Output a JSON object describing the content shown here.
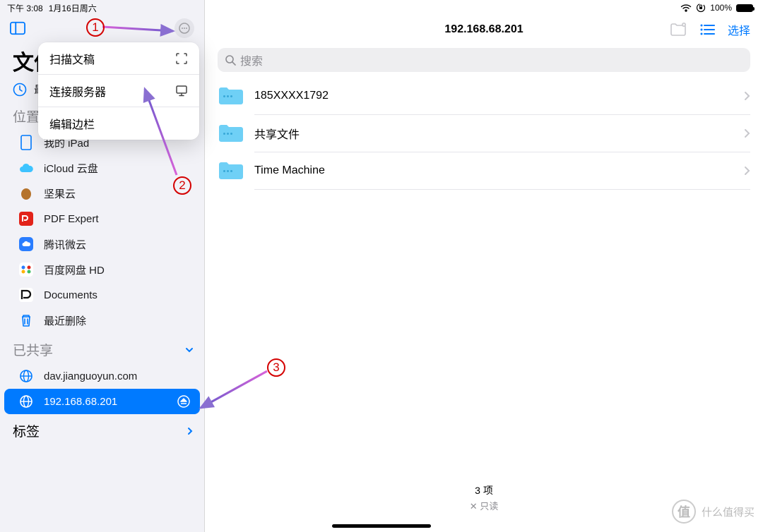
{
  "status": {
    "time": "下午 3:08",
    "date": "1月16日周六",
    "battery": "100%"
  },
  "sidebar": {
    "title": "文件",
    "recent": "最近",
    "sections": {
      "locations": {
        "label": "位置",
        "items": [
          {
            "label": "我的 iPad"
          },
          {
            "label": "iCloud 云盘"
          },
          {
            "label": "坚果云"
          },
          {
            "label": "PDF Expert"
          },
          {
            "label": "腾讯微云"
          },
          {
            "label": "百度网盘 HD"
          },
          {
            "label": "Documents"
          },
          {
            "label": "最近删除"
          }
        ]
      },
      "shared": {
        "label": "已共享",
        "items": [
          {
            "label": "dav.jianguoyun.com"
          },
          {
            "label": "192.168.68.201"
          }
        ]
      },
      "tags": {
        "label": "标签"
      }
    }
  },
  "popup": {
    "items": [
      {
        "label": "扫描文稿"
      },
      {
        "label": "连接服务器"
      },
      {
        "label": "编辑边栏"
      }
    ]
  },
  "main": {
    "title": "192.168.68.201",
    "select": "选择",
    "search_placeholder": "搜索",
    "rows": [
      {
        "name": "185XXXX1792"
      },
      {
        "name": "共享文件"
      },
      {
        "name": "Time Machine"
      }
    ],
    "count": "3 项",
    "readonly": "只读"
  },
  "annotations": {
    "n1": "1",
    "n2": "2",
    "n3": "3"
  },
  "watermark": {
    "char": "值",
    "text": "什么值得买"
  }
}
